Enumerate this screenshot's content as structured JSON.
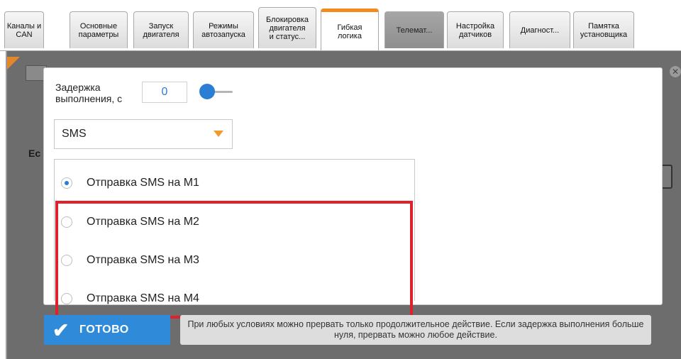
{
  "tabs": [
    {
      "label": "Каналы и\nCAN"
    },
    {
      "label": "Основные\nпараметры"
    },
    {
      "label": "Запуск\nдвигателя"
    },
    {
      "label": "Режимы\nавтозапуска"
    },
    {
      "label": "Блокировка\nдвигателя\nи статус..."
    },
    {
      "label": "Гибкая\nлогика"
    },
    {
      "label": "Телемат..."
    },
    {
      "label": "Настройка\nдатчиков"
    },
    {
      "label": "Диагност..."
    },
    {
      "label": "Памятка\nустановщика"
    }
  ],
  "active_tab": "Гибкая логика",
  "background": {
    "partial_text": "Ес"
  },
  "dialog": {
    "delay_label": "Задержка\nвыполнения, с",
    "delay_value": "0",
    "action_select": "SMS",
    "options": [
      {
        "label": "Отправка SMS на М1",
        "checked": true
      },
      {
        "label": "Отправка SMS на М2",
        "checked": false
      },
      {
        "label": "Отправка SMS на М3",
        "checked": false
      },
      {
        "label": "Отправка SMS на М4",
        "checked": false
      }
    ]
  },
  "footer": {
    "done_label": "ГОТОВО",
    "note": "При любых условиях можно прервать только продолжительное действие. Если задержка выполнения больше нуля, прервать можно любое действие."
  },
  "colors": {
    "accent_blue": "#2f8bd9",
    "tab_active_orange": "#f28a1e",
    "highlight_red": "#e0202a",
    "overlay_gray": "#6d6d6d"
  },
  "icons": {
    "done": "check-icon",
    "select": "caret-down-icon",
    "dialog_close": "close-icon"
  }
}
